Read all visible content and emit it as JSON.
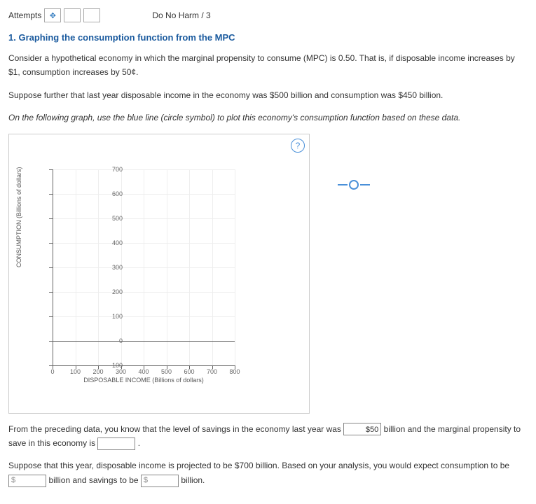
{
  "header": {
    "attempts_label": "Attempts",
    "attempts_icon": "✥",
    "do_no_harm": "Do No Harm / 3"
  },
  "question": {
    "title": "1. Graphing the consumption function from the MPC",
    "p1": "Consider a hypothetical economy in which the marginal propensity to consume (MPC) is 0.50. That is, if disposable income increases by $1, consumption increases by 50¢.",
    "p2": "Suppose further that last year disposable income in the economy was $500 billion and consumption was $450 billion.",
    "instruction": "On the following graph, use the blue line (circle symbol) to plot this economy's consumption function based on these data."
  },
  "chart_data": {
    "type": "line",
    "title": "",
    "xlabel": "DISPOSABLE INCOME (Billions of dollars)",
    "ylabel": "CONSUMPTION (Billions of dollars)",
    "xlim": [
      0,
      800
    ],
    "ylim": [
      -100,
      700
    ],
    "x_ticks": [
      0,
      100,
      200,
      300,
      400,
      500,
      600,
      700,
      800
    ],
    "y_ticks": [
      -100,
      0,
      100,
      200,
      300,
      400,
      500,
      600,
      700
    ],
    "series": [
      {
        "name": "Consumption Function",
        "color": "#4a90d9",
        "symbol": "circle",
        "values": []
      }
    ]
  },
  "help_glyph": "?",
  "followup": {
    "pre_savings": "From the preceding data, you know that the level of savings in the economy last year was",
    "savings_value": "$50",
    "post_savings_a": "billion and the marginal propensity to save in this",
    "post_savings_b": "economy is",
    "period": ".",
    "p2a": "Suppose that this year, disposable income is projected to be $700 billion. Based on your analysis, you would expect consumption to be",
    "p2b": "billion and savings to be",
    "p2c": "billion.",
    "dollar": "$"
  }
}
